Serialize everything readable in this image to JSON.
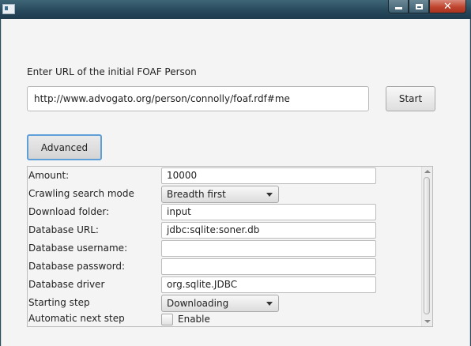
{
  "window": {
    "title": "",
    "minimize_icon": "minimize-icon",
    "maximize_icon": "maximize-icon",
    "close_icon": "close-icon",
    "close_glyph": "✕"
  },
  "main": {
    "prompt_label": "Enter URL of the initial FOAF Person",
    "url_value": "http://www.advogato.org/person/connolly/foaf.rdf#me",
    "start_label": "Start",
    "advanced_label": "Advanced"
  },
  "settings": {
    "amount_label": "Amount:",
    "amount_value": "10000",
    "crawl_mode_label": "Crawling search mode",
    "crawl_mode_value": "Breadth first",
    "download_folder_label": "Download folder:",
    "download_folder_value": "input",
    "db_url_label": "Database URL:",
    "db_url_value": "jdbc:sqlite:soner.db",
    "db_user_label": "Database username:",
    "db_user_value": "",
    "db_pass_label": "Database password:",
    "db_pass_value": "",
    "db_driver_label": "Database driver",
    "db_driver_value": "org.sqlite.JDBC",
    "start_step_label": "Starting step",
    "start_step_value": "Downloading",
    "auto_next_label": "Automatic next step",
    "auto_next_checkbox_label": "Enable",
    "auto_next_checked": false
  },
  "colors": {
    "focus_border": "#5f9fd8",
    "close_button": "#c0452f"
  }
}
